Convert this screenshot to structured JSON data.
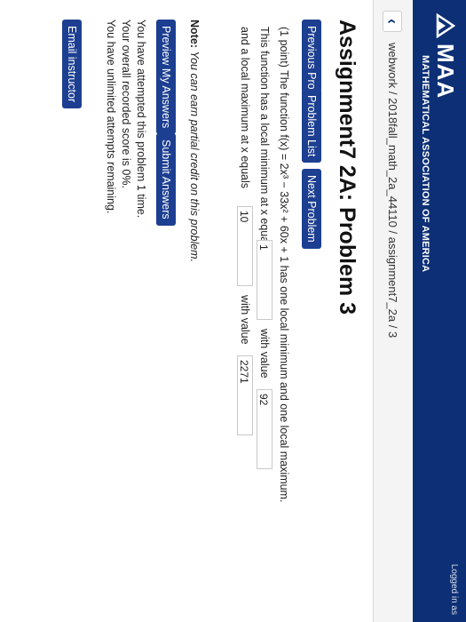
{
  "header": {
    "logo_text": "MAA",
    "org_name": "MATHEMATICAL ASSOCIATION OF AMERICA",
    "logged_in": "Logged in as"
  },
  "breadcrumb": {
    "back_icon": "chevron-left-icon",
    "path": "webwork / 2018fall_math_2a_44110 / assignment7_2a / 3"
  },
  "page": {
    "title": "Assignment7 2A: Problem 3"
  },
  "nav_buttons": {
    "previous": "Previous Problem",
    "list": "Problem List",
    "next": "Next Problem"
  },
  "problem": {
    "line1": "(1 point) The function f(x) = 2x³ − 33x² + 60x + 1 has one local minimum and one local maximum.",
    "line2_prefix": "This function has a local minimum at x equals",
    "min_x": "1",
    "with_value_1": "with value",
    "min_value": "92",
    "line3_prefix": "and a local maximum at x equals",
    "max_x": "10",
    "with_value_2": "with value",
    "max_value": "2271"
  },
  "note": {
    "label": "Note:",
    "text": "You can earn partial credit on this problem."
  },
  "action_buttons": {
    "preview": "Preview My Answers",
    "submit": "Submit Answers"
  },
  "status": {
    "attempted": "You have attempted this problem 1 time.",
    "score": "Your overall recorded score is 0%.",
    "remaining": "You have unlimited attempts remaining."
  },
  "footer": {
    "email": "Email instructor"
  },
  "colors": {
    "brand": "#0c2f75",
    "button": "#1d3f91"
  }
}
